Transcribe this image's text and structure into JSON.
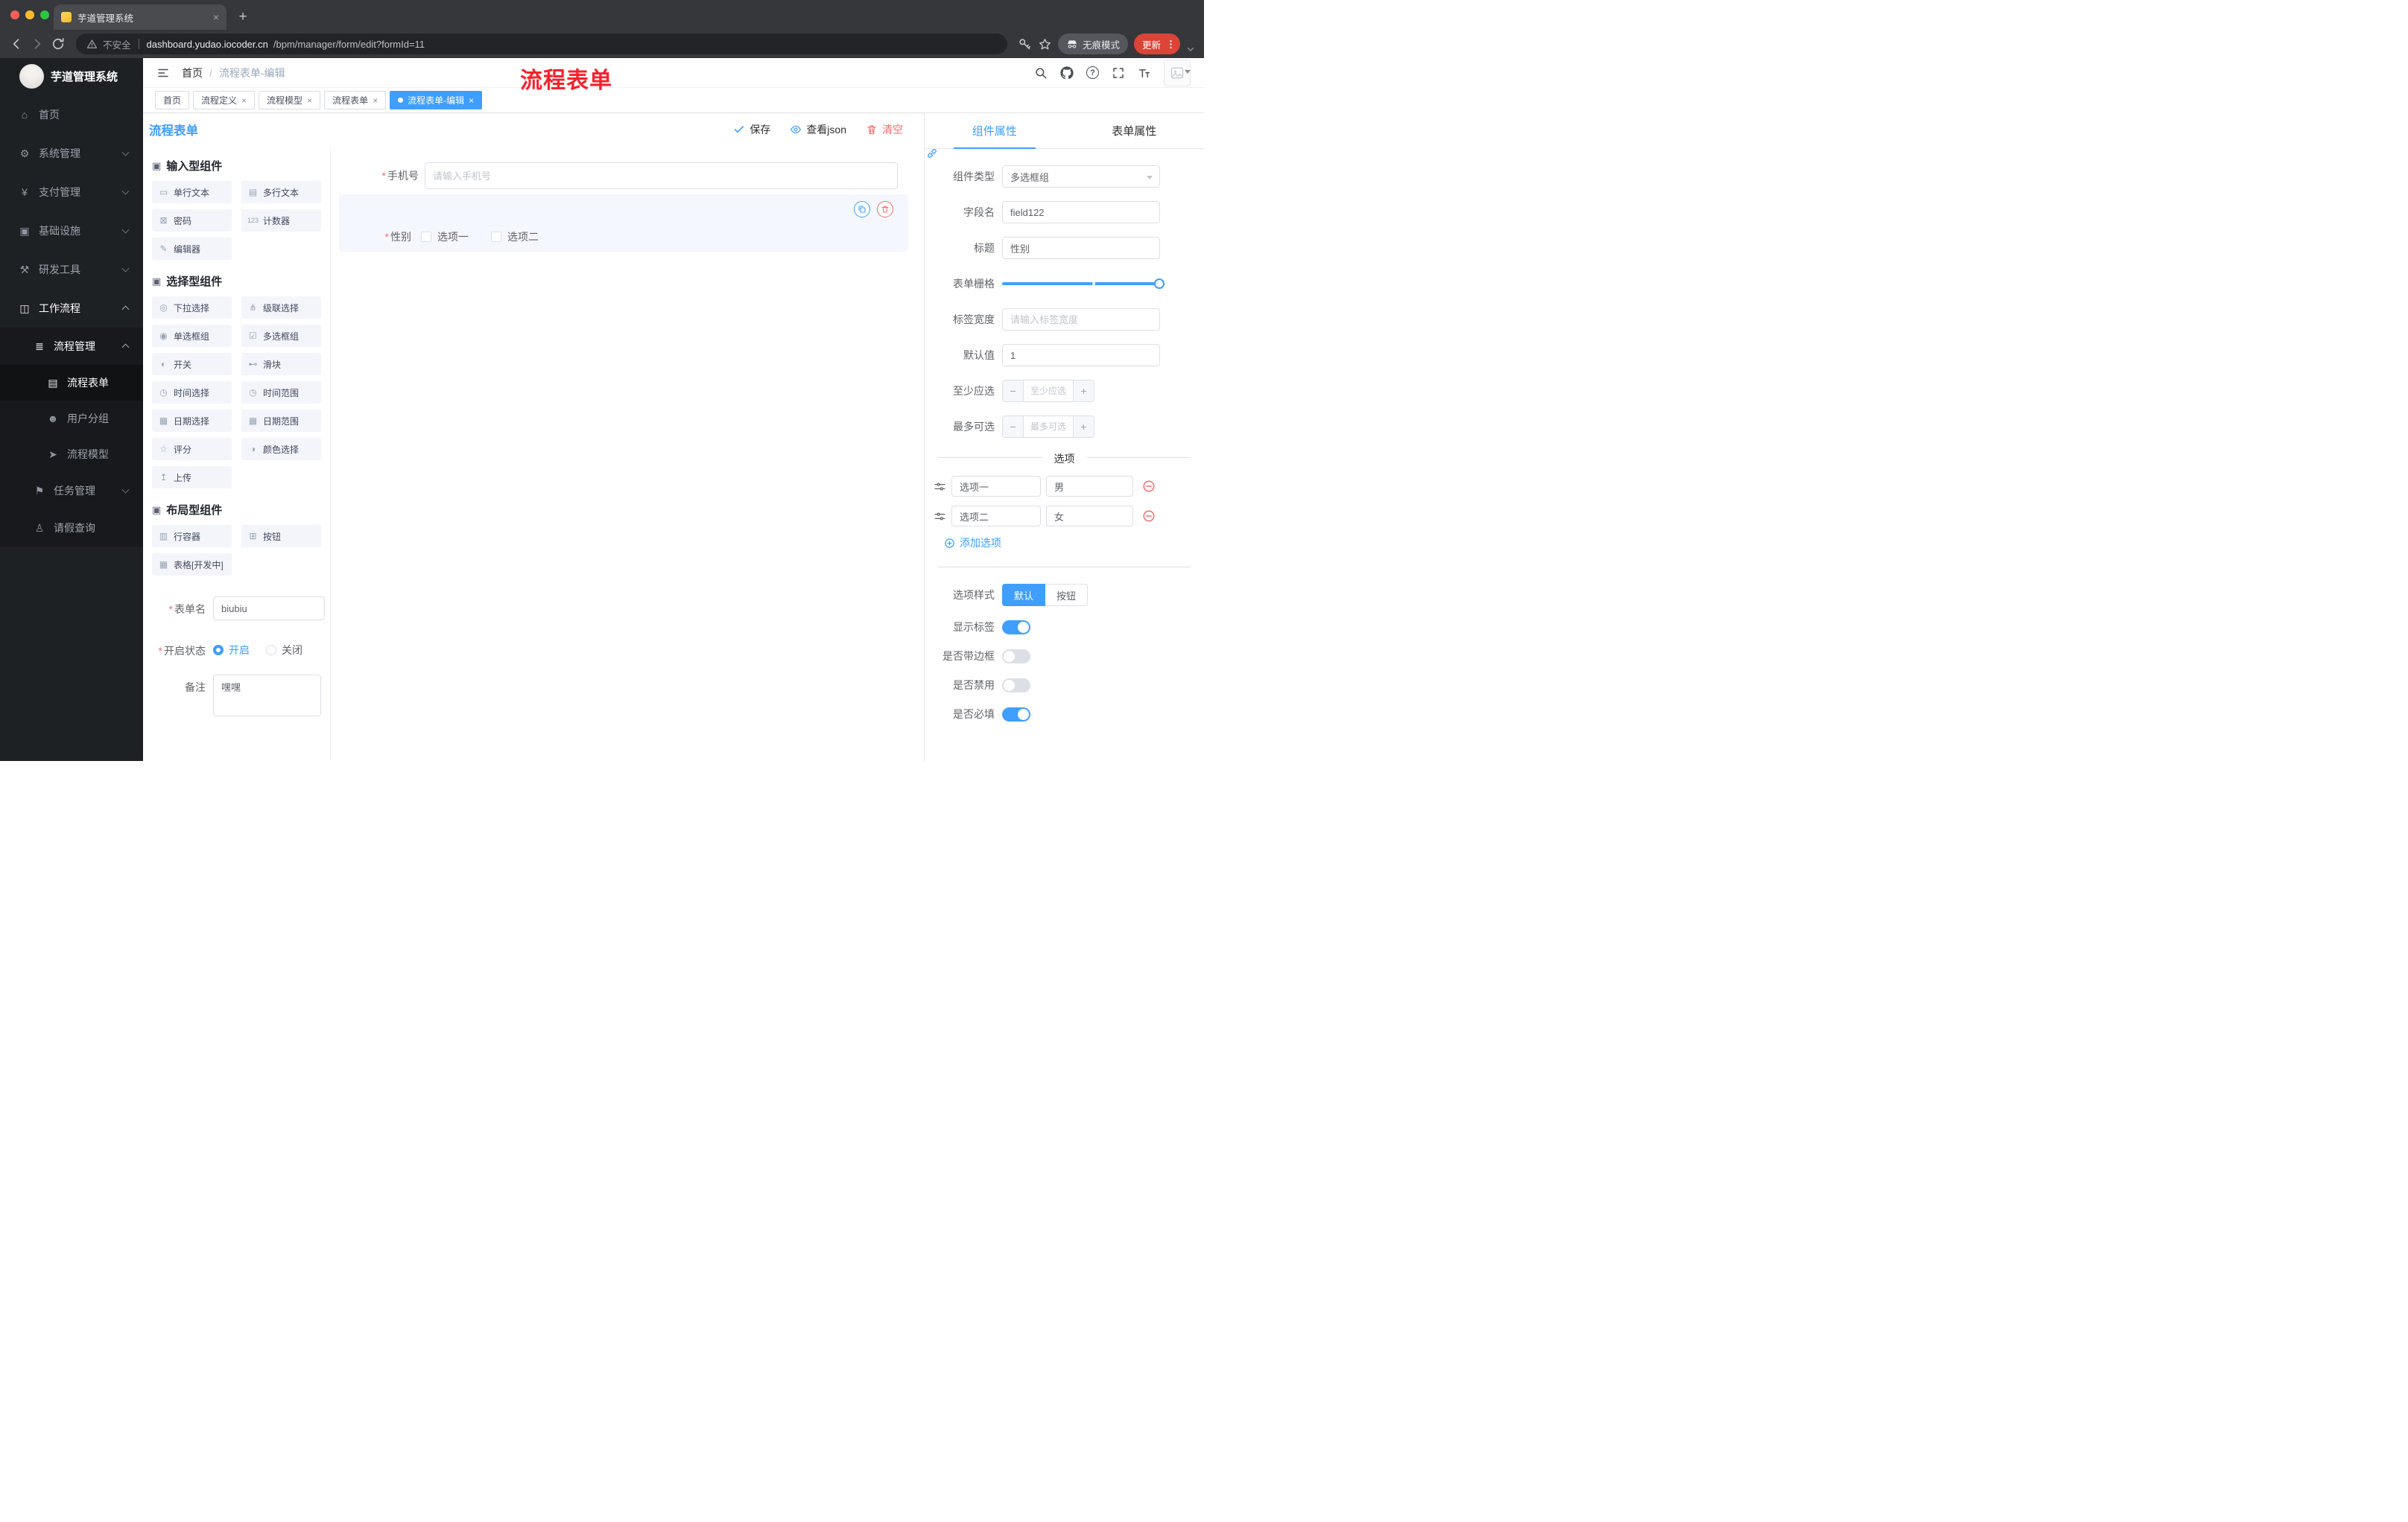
{
  "colors": {
    "primary": "#409eff",
    "danger": "#f56c6c",
    "annotation_red": "#f5222d"
  },
  "browser": {
    "tab_title": "芋道管理系统",
    "close_glyph": "×",
    "new_tab_glyph": "+",
    "security_label": "不安全",
    "url_domain": "dashboard.yudao.iocoder.cn",
    "url_path": "/bpm/manager/form/edit?formId=11",
    "incognito_label": "无痕模式",
    "update_label": "更新"
  },
  "sidebar": {
    "logo_title": "芋道管理系统",
    "items": [
      {
        "label": "首页",
        "icon": "⌂"
      },
      {
        "label": "系统管理",
        "icon": "⚙"
      },
      {
        "label": "支付管理",
        "icon": "¥"
      },
      {
        "label": "基础设施",
        "icon": "▣"
      },
      {
        "label": "研发工具",
        "icon": "⚒"
      },
      {
        "label": "工作流程",
        "icon": "◫"
      },
      {
        "label": "流程管理",
        "icon": "≣"
      },
      {
        "label": "流程表单",
        "icon": "▤"
      },
      {
        "label": "用户分组",
        "icon": "☻"
      },
      {
        "label": "流程模型",
        "icon": "➤"
      },
      {
        "label": "任务管理",
        "icon": "⚑"
      },
      {
        "label": "请假查询",
        "icon": "♙"
      }
    ]
  },
  "header": {
    "breadcrumb_home": "首页",
    "breadcrumb_sep": "/",
    "breadcrumb_current": "流程表单-编辑",
    "annotation": "流程表单"
  },
  "tags": {
    "close_glyph": "×",
    "items": [
      {
        "label": "首页"
      },
      {
        "label": "流程定义"
      },
      {
        "label": "流程模型"
      },
      {
        "label": "流程表单"
      },
      {
        "label": "流程表单-编辑"
      }
    ]
  },
  "designer": {
    "title": "流程表单",
    "save": "保存",
    "view_json": "查看json",
    "clear": "清空",
    "required_mark": "*"
  },
  "palette": {
    "groups": [
      {
        "title": "输入型组件",
        "items": [
          {
            "label": "单行文本",
            "icon": "▭"
          },
          {
            "label": "多行文本",
            "icon": "▤"
          },
          {
            "label": "密码",
            "icon": "⊠"
          },
          {
            "label": "计数器",
            "icon": "123"
          },
          {
            "label": "编辑器",
            "icon": "✎"
          }
        ]
      },
      {
        "title": "选择型组件",
        "items": [
          {
            "label": "下拉选择",
            "icon": "◎"
          },
          {
            "label": "级联选择",
            "icon": "⋔"
          },
          {
            "label": "单选框组",
            "icon": "◉"
          },
          {
            "label": "多选框组",
            "icon": "☑"
          },
          {
            "label": "开关",
            "icon": "◐"
          },
          {
            "label": "滑块",
            "icon": "⊷"
          },
          {
            "label": "时间选择",
            "icon": "◷"
          },
          {
            "label": "时间范围",
            "icon": "◷"
          },
          {
            "label": "日期选择",
            "icon": "▦"
          },
          {
            "label": "日期范围",
            "icon": "▦"
          },
          {
            "label": "评分",
            "icon": "☆"
          },
          {
            "label": "颜色选择",
            "icon": "◑"
          },
          {
            "label": "上传",
            "icon": "↥"
          }
        ]
      },
      {
        "title": "布局型组件",
        "items": [
          {
            "label": "行容器",
            "icon": "▥"
          },
          {
            "label": "按钮",
            "icon": "⊞"
          },
          {
            "label": "表格[开发中]",
            "icon": "▦"
          }
        ]
      }
    ],
    "form": {
      "name_label": "表单名",
      "name_value": "biubiu",
      "status_label": "开启状态",
      "on_label": "开启",
      "off_label": "关闭",
      "remark_label": "备注",
      "remark_value": "嘿嘿"
    }
  },
  "canvas": {
    "phone": {
      "label": "手机号",
      "placeholder": "请输入手机号"
    },
    "gender": {
      "label": "性别",
      "opt1": "选项一",
      "opt2": "选项二"
    }
  },
  "props": {
    "tab_component": "组件属性",
    "tab_form": "表单属性",
    "rows": {
      "type_label": "组件类型",
      "type_value": "多选框组",
      "field_label": "字段名",
      "field_value": "field122",
      "title_label": "标题",
      "title_value": "性别",
      "grid_label": "表单栅格",
      "width_label": "标签宽度",
      "width_placeholder": "请输入标签宽度",
      "default_label": "默认值",
      "default_value": "1",
      "min_label": "至少应选",
      "min_placeholder": "至少应选",
      "max_label": "最多可选",
      "max_placeholder": "最多可选"
    },
    "options": {
      "divider": "选项",
      "rows": [
        {
          "name": "选项一",
          "value": "男"
        },
        {
          "name": "选项二",
          "value": "女"
        }
      ],
      "add_label": "添加选项"
    },
    "style": {
      "label": "选项样式",
      "default_btn": "默认",
      "button_btn": "按钮"
    },
    "switches": [
      {
        "label": "显示标签",
        "on": true
      },
      {
        "label": "是否带边框",
        "on": false
      },
      {
        "label": "是否禁用",
        "on": false
      },
      {
        "label": "是否必填",
        "on": true
      }
    ]
  },
  "icons": {
    "question": "?",
    "minus": "−",
    "plus": "+"
  }
}
